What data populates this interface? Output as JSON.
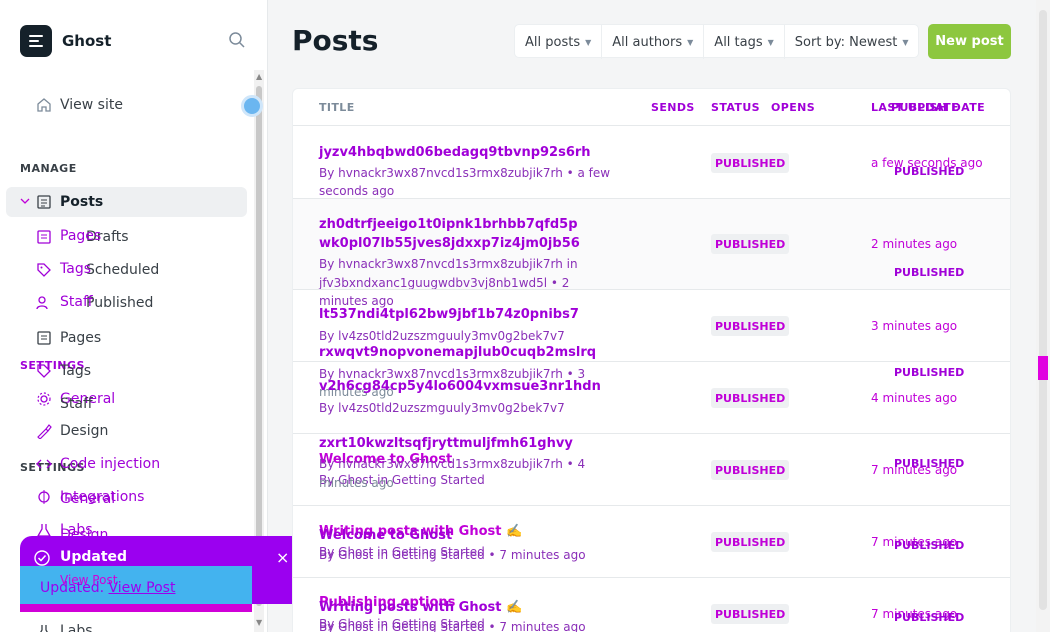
{
  "brand": {
    "name": "Ghost"
  },
  "sidebar": {
    "view_site": "View site",
    "manage_heading": "MANAGE",
    "settings_heading": "SETTINGS",
    "settings_heading_2": "SETTINGS",
    "posts": "Posts",
    "drafts": "Drafts",
    "scheduled": "Scheduled",
    "published": "Published",
    "pages": "Pages",
    "tags": "Tags",
    "staff": "Staff",
    "general": "General",
    "design": "Design",
    "code_injection": "Code injection",
    "integrations": "Integrations",
    "labs": "Labs",
    "ghost_pages": "Pages",
    "ghost_tags": "Tags",
    "ghost_staff": "Staff",
    "ghost_general": "General",
    "ghost_design": "Design",
    "ghost_labs": "Labs"
  },
  "toast": {
    "title": "Updated",
    "close": "×",
    "message": "Updated.",
    "link": "View Post",
    "ghost_link": "View Post"
  },
  "header": {
    "title": "Posts",
    "new_post": "New post",
    "filters": [
      "All posts",
      "All authors",
      "All tags",
      "Sort by: Newest"
    ]
  },
  "table": {
    "columns": {
      "title": "TITLE",
      "sends": "SENDS",
      "status": "STATUS",
      "opens": "OPENS",
      "last_update": "LAST UPDATE",
      "publish_date": "PUBLISH DATE"
    },
    "rows": [
      {
        "title": "jyzv4hbqbwd06bedagq9tbvnp92s6rh",
        "meta": "By hvnackr3wx87nvcd1s3rmx8zubjik7rh • a few",
        "meta2": "seconds ago",
        "status": "PUBLISHED",
        "updated": "a few seconds ago",
        "pub": "PUBLISHED"
      },
      {
        "title": "zh0dtrfjeeigo1t0ipnk1brhbb7qfd5p",
        "title2": "wk0pl07lb55jves8jdxxp7iz4jm0jb56",
        "meta": "By hvnackr3wx87nvcd1s3rmx8zubjik7rh in",
        "meta2": "jfv3bxndxanc1guugwdbv3vj8nb1wd5l • 2",
        "meta3": "minutes ago",
        "status": "PUBLISHED",
        "updated": "2 minutes ago",
        "pub": "PUBLISHED"
      },
      {
        "title": "lt537ndi4tpl62bw9jbf1b74z0pnibs7",
        "meta": "By lv4zs0tld2uzszmguuly3mv0g2bek7v7",
        "status": "PUBLISHED",
        "updated": "3 minutes ago"
      },
      {
        "title": "rxwqvt9nopvonemapjlub0cuqb2mslrq",
        "meta": "By hvnackr3wx87nvcd1s3rmx8zubjik7rh • 3",
        "meta2": "minutes ago",
        "pub": "PUBLISHED"
      },
      {
        "title": "v2h6cg84cp5y4lo6004vxmsue3nr1hdn",
        "meta": "By lv4zs0tld2uzszmguuly3mv0g2bek7v7",
        "status": "PUBLISHED",
        "updated": "4 minutes ago"
      },
      {
        "title": "zxrt10kwzltsqfjryttmuljfmh61ghvy",
        "meta": "By hvnackr3wx87nvcd1s3rmx8zubjik7rh • 4",
        "meta2": "minutes ago",
        "title2": "Welcome to Ghost",
        "meta3": "By Ghost in Getting Started",
        "status": "PUBLISHED",
        "updated": "7 minutes ago",
        "pub": "PUBLISHED"
      },
      {
        "title": "Writing posts with Ghost ✍️",
        "title2": "Welcome to Ghost",
        "meta": "By Ghost in Getting Started",
        "meta2": "By Ghost in Getting Started • 7 minutes ago",
        "status": "PUBLISHED",
        "updated": "7 minutes ago",
        "pub": "PUBLISHED"
      },
      {
        "title": "Publishing options",
        "title2": "Writing posts with Ghost ✍️",
        "meta": "By Ghost in Getting Started",
        "meta2": "By Ghost in Getting Started • 7 minutes ago",
        "status": "PUBLISHED",
        "updated": "7 minutes ago",
        "pub": "PUBLISHED"
      }
    ]
  }
}
